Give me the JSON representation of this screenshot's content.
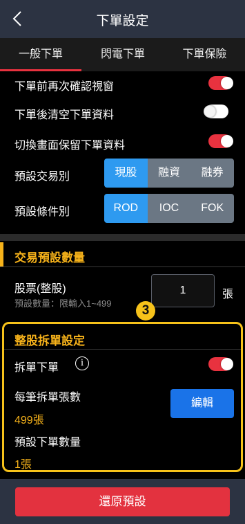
{
  "header": {
    "title": "下單設定",
    "back_icon": "chevron-left-icon"
  },
  "tabs": [
    {
      "label": "一般下單",
      "active": true
    },
    {
      "label": "閃電下單",
      "active": false
    },
    {
      "label": "下單保險",
      "active": false
    }
  ],
  "settings": {
    "confirm_window": {
      "label": "下單前再次確認視窗",
      "on": true
    },
    "clear_after": {
      "label": "下單後清空下單資料",
      "on": false
    },
    "keep_on_switch": {
      "label": "切換畫面保留下單資料",
      "on": true
    }
  },
  "trade_type": {
    "label": "預設交易別",
    "options": [
      "現股",
      "融資",
      "融券"
    ],
    "selected": "現股"
  },
  "condition_type": {
    "label": "預設條件別",
    "options": [
      "ROD",
      "IOC",
      "FOK"
    ],
    "selected": "ROD"
  },
  "default_qty_section": {
    "title": "交易預設數量",
    "stock_label": "股票(整股)",
    "hint": "預設數量：限輸入1~499",
    "value": "1",
    "unit": "張"
  },
  "split_section": {
    "badge": "3",
    "title": "整股拆單設定",
    "split_label": "拆單下單",
    "split_on": true,
    "info_icon": "i",
    "per_order_label": "每筆拆單張數",
    "per_order_value": "499張",
    "edit_label": "編輯",
    "default_order_label": "預設下單數量",
    "default_order_value": "1張"
  },
  "footer": {
    "reset_label": "還原預設"
  },
  "colors": {
    "accent_red": "#e8323f",
    "accent_yellow": "#f6b21a",
    "select_blue": "#2e9af0",
    "header_bg": "#2c3342"
  }
}
